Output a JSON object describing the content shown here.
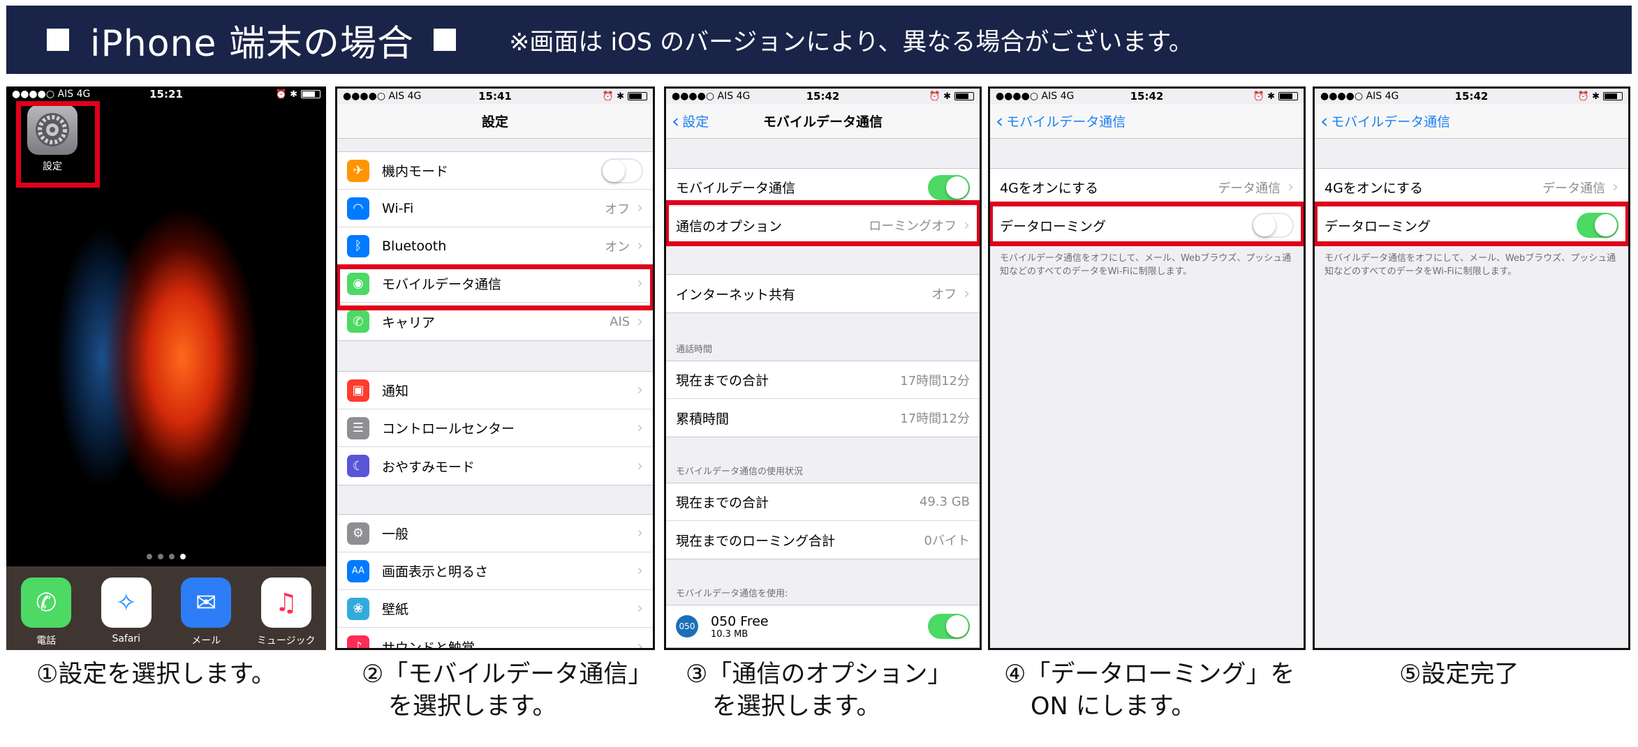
{
  "banner": {
    "title": "iPhone 端末の場合",
    "note": "※画面は iOS のバージョンにより、異なる場合がございます。"
  },
  "status": {
    "carrier": "●●●●○ AIS  4G",
    "time1": "15:21",
    "time2": "15:41",
    "time3": "15:42",
    "time4": "15:42",
    "time5": "15:42",
    "icons": "⏰ ✱"
  },
  "home": {
    "settings_label": "設定",
    "dock": [
      {
        "name": "電話",
        "icon": "phone-icon",
        "color": "#4cd964",
        "glyph": "✆"
      },
      {
        "name": "Safari",
        "icon": "compass-icon",
        "color": "#1e90ff",
        "glyph": "✧"
      },
      {
        "name": "メール",
        "icon": "mail-icon",
        "color": "#2d7df6",
        "glyph": "✉"
      },
      {
        "name": "ミュージック",
        "icon": "music-icon",
        "color": "#ff2d55",
        "glyph": "♫"
      }
    ]
  },
  "settings": {
    "title": "設定",
    "items": [
      {
        "label": "機内モード",
        "value": "",
        "icon": "airplane-icon",
        "color": "#ff9500",
        "glyph": "✈"
      },
      {
        "label": "Wi-Fi",
        "value": "オフ",
        "icon": "wifi-icon",
        "color": "#007aff",
        "glyph": "◠"
      },
      {
        "label": "Bluetooth",
        "value": "オン",
        "icon": "bluetooth-icon",
        "color": "#007aff",
        "glyph": "ᛒ"
      },
      {
        "label": "モバイルデータ通信",
        "value": "",
        "icon": "antenna-icon",
        "color": "#4cd964",
        "glyph": "◉"
      },
      {
        "label": "キャリア",
        "value": "AIS",
        "icon": "phone-icon",
        "color": "#4cd964",
        "glyph": "✆"
      },
      {
        "label": "通知",
        "value": "",
        "icon": "notification-icon",
        "color": "#ff3b30",
        "glyph": "▣"
      },
      {
        "label": "コントロールセンター",
        "value": "",
        "icon": "switches-icon",
        "color": "#8e8e93",
        "glyph": "☰"
      },
      {
        "label": "おやすみモード",
        "value": "",
        "icon": "moon-icon",
        "color": "#5856d6",
        "glyph": "☾"
      },
      {
        "label": "一般",
        "value": "",
        "icon": "gear-icon",
        "color": "#8e8e93",
        "glyph": "⚙"
      },
      {
        "label": "画面表示と明るさ",
        "value": "",
        "icon": "text-size-icon",
        "color": "#007aff",
        "glyph": "AA"
      },
      {
        "label": "壁紙",
        "value": "",
        "icon": "flower-icon",
        "color": "#34aadc",
        "glyph": "❀"
      },
      {
        "label": "サウンドと触覚",
        "value": "",
        "icon": "speaker-icon",
        "color": "#ff2d55",
        "glyph": "♪"
      }
    ]
  },
  "mobile": {
    "back": "設定",
    "title": "モバイルデータ通信",
    "cellular_label": "モバイルデータ通信",
    "options_label": "通信のオプション",
    "options_value": "ローミングオフ",
    "hotspot_label": "インターネット共有",
    "hotspot_value": "オフ",
    "call_header": "通話時間",
    "call_current_label": "現在までの合計",
    "call_current_value": "17時間12分",
    "call_total_label": "累積時間",
    "call_total_value": "17時間12分",
    "usage_header": "モバイルデータ通信の使用状況",
    "usage_current_label": "現在までの合計",
    "usage_current_value": "49.3 GB",
    "usage_roaming_label": "現在までのローミング合計",
    "usage_roaming_value": "0バイト",
    "apps_header": "モバイルデータ通信を使用:",
    "app_name": "050 Free",
    "app_size": "10.3 MB"
  },
  "options": {
    "back": "モバイルデータ通信",
    "lte_label": "4Gをオンにする",
    "lte_value": "データ通信",
    "roaming_label": "データローミング",
    "footnote": "モバイルデータ通信をオフにして、メール、Webブラウズ、プッシュ通知などのすべてのデータをWi-Fiに制限します。"
  },
  "captions": {
    "c1": "①設定を選択します。",
    "c2a": "②「モバイルデータ通信」",
    "c2b": "を選択します。",
    "c3a": "③「通信のオプション」",
    "c3b": "を選択します。",
    "c4a": "④「データローミング」を",
    "c4b": "ON にします。",
    "c5": "⑤設定完了"
  },
  "colors": {
    "banner": "#1a2448",
    "highlight": "#e0001b",
    "ios_blue": "#1b7ef6",
    "toggle_on": "#4cd964"
  }
}
